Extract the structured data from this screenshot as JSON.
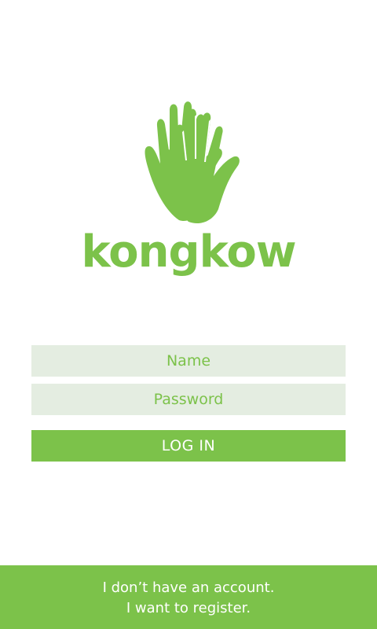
{
  "logo": {
    "icon": "hand-icon",
    "text": "kongkow",
    "color": "#7cc24a"
  },
  "form": {
    "name_placeholder": "Name",
    "password_placeholder": "Password",
    "login_label": "LOG IN"
  },
  "register": {
    "line1": "I don’t have an account.",
    "line2": "I want to register."
  },
  "colors": {
    "accent": "#7cc24a",
    "field_background": "#e4ede1",
    "background": "#ffffff"
  }
}
